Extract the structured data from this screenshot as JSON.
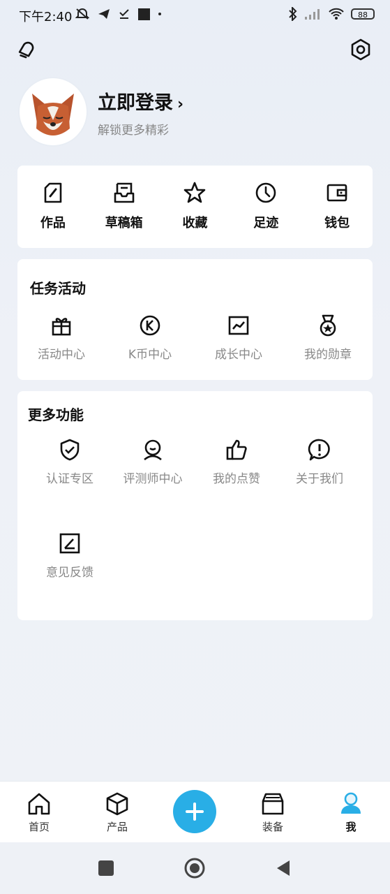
{
  "status_bar": {
    "time": "下午2:40",
    "battery": "88"
  },
  "profile": {
    "login_title": "立即登录",
    "login_chevron": "›",
    "subtitle": "解锁更多精彩"
  },
  "quick_actions": [
    {
      "label": "作品",
      "icon": "edit-square-icon"
    },
    {
      "label": "草稿箱",
      "icon": "drafts-icon"
    },
    {
      "label": "收藏",
      "icon": "star-icon"
    },
    {
      "label": "足迹",
      "icon": "clock-icon"
    },
    {
      "label": "钱包",
      "icon": "wallet-icon"
    }
  ],
  "tasks": {
    "title": "任务活动",
    "items": [
      {
        "label": "活动中心",
        "icon": "gift-icon"
      },
      {
        "label": "K币中心",
        "icon": "k-coin-icon"
      },
      {
        "label": "成长中心",
        "icon": "growth-chart-icon"
      },
      {
        "label": "我的勋章",
        "icon": "medal-icon"
      }
    ]
  },
  "more": {
    "title": "更多功能",
    "items": [
      {
        "label": "认证专区",
        "icon": "shield-check-icon"
      },
      {
        "label": "评测师中心",
        "icon": "reviewer-icon"
      },
      {
        "label": "我的点赞",
        "icon": "thumbs-up-icon"
      },
      {
        "label": "关于我们",
        "icon": "info-icon"
      },
      {
        "label": "意见反馈",
        "icon": "feedback-icon"
      }
    ]
  },
  "tab_bar": {
    "items": [
      {
        "label": "首页",
        "icon": "home-icon"
      },
      {
        "label": "产品",
        "icon": "box-icon"
      },
      {
        "label": "装备",
        "icon": "equipment-icon"
      },
      {
        "label": "我",
        "icon": "user-icon",
        "active": true
      }
    ],
    "accent": "#29aee6"
  }
}
